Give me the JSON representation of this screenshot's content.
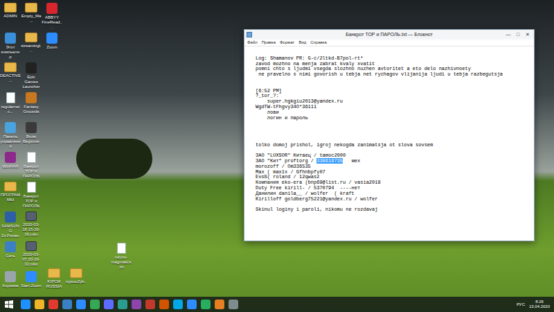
{
  "desktop": {
    "columns": [
      [
        {
          "label": "ADMIN",
          "kind": "folder",
          "color": "#e8b84a"
        },
        {
          "label": "Этот компьютер",
          "kind": "app",
          "color": "#3a8fd8"
        },
        {
          "label": "DEACTIVE ...",
          "kind": "folder",
          "color": "#e8b84a"
        },
        {
          "label": "regularnetc...",
          "kind": "file",
          "color": "#ffffff"
        },
        {
          "label": "Панель управления",
          "kind": "app",
          "color": "#4aa3df"
        },
        {
          "label": "WinRAR",
          "kind": "app",
          "color": "#8b2a8b"
        },
        {
          "label": "ПРОГРАММЫ",
          "kind": "folder",
          "color": "#e8b84a"
        },
        {
          "label": "SAMSUNG Dr.Printer",
          "kind": "app",
          "color": "#2c5fa8"
        },
        {
          "label": "Сеть",
          "kind": "app",
          "color": "#3b7fc4"
        },
        {
          "label": "Корзина",
          "kind": "app",
          "color": "#9aa4ad"
        }
      ],
      [
        {
          "label": "Empty_Ma...",
          "kind": "folder",
          "color": "#e8b84a"
        },
        {
          "label": "streamingl...",
          "kind": "folder",
          "color": "#e8b84a"
        },
        {
          "label": "Epic Games Launcher",
          "kind": "app",
          "color": "#222222"
        },
        {
          "label": "Fantasy Grounds",
          "kind": "app",
          "color": "#c8781e"
        },
        {
          "label": "Brute Beginner",
          "kind": "app",
          "color": "#3a3a3a"
        },
        {
          "label": "Банкрот ТОР и ПАРОЛЬ",
          "kind": "file",
          "color": "#ffffff"
        },
        {
          "label": "Банкрот ТОР и ПАРОЛЬ",
          "kind": "file",
          "color": "#ffffff"
        },
        {
          "label": "2020-03-18 15-26-36.mkv",
          "kind": "video",
          "color": "#556070"
        },
        {
          "label": "2020-03-07 20-29-32.mkv",
          "kind": "video",
          "color": "#556070"
        },
        {
          "label": "Start Zoom",
          "kind": "app",
          "color": "#2d8cff"
        }
      ],
      [
        {
          "label": "ABBYY FineRead...",
          "kind": "app",
          "color": "#d8262e"
        },
        {
          "label": "Zoom",
          "kind": "app",
          "color": "#2d8cff"
        }
      ]
    ],
    "bottom_row": [
      {
        "label": "ЮРСМ RUSSIA",
        "kind": "folder",
        "color": "#e8b84a"
      },
      {
        "label": "курсыZyk...",
        "kind": "folder",
        "color": "#e8b84a"
      }
    ],
    "loose_file": {
      "label": "rsforsi-magmatics.txt",
      "kind": "file",
      "color": "#ffffff"
    }
  },
  "window": {
    "title": "Банкрот ТОР и ПАРОЛЬ.txt — Блокнот",
    "controls": [
      "—",
      "□",
      "✕"
    ],
    "menu": [
      "Файл",
      "Правка",
      "Формат",
      "Вид",
      "Справка"
    ],
    "lines": [
      {
        "segments": []
      },
      {
        "segments": [
          {
            "text": "Log: Shamanov PR: G-c/2ltkd-B7pol-rt*",
            "selected": false
          }
        ]
      },
      {
        "segments": [
          {
            "text": "zavod mozhno na menja zabrat kvaly xvatit",
            "selected": false
          }
        ]
      },
      {
        "segments": [
          {
            "text": "pomni chto s ljudmi vsegda slozhno nuzhen avtoritet a eto delo nazhivnoety",
            "selected": false
          }
        ]
      },
      {
        "segments": [
          {
            "text": " ne pravelno s nimi govorish u tebja net rychagov vlijanija ljudi u tebja razbegutsja",
            "selected": false
          }
        ]
      },
      {
        "segments": []
      },
      {
        "segments": []
      },
      {
        "segments": [
          {
            "text": "[6:52 PM]",
            "selected": false
          }
        ]
      },
      {
        "segments": [
          {
            "text": "?_tor_?:",
            "selected": false
          }
        ]
      },
      {
        "segments": [
          {
            "text": "    super.hgkgiu2013@yandex.ru",
            "selected": false
          }
        ]
      },
      {
        "segments": [
          {
            "text": "WgdTW-tFhgvy34O*36111",
            "selected": false
          }
        ]
      },
      {
        "segments": [
          {
            "text": "    лови",
            "selected": false
          }
        ]
      },
      {
        "segments": [
          {
            "text": "    логин и пароль",
            "selected": false
          }
        ]
      },
      {
        "segments": []
      },
      {
        "segments": []
      },
      {
        "segments": []
      },
      {
        "segments": []
      },
      {
        "segments": [
          {
            "text": "tolko domoj prishol, igroj nekogda zanimatsja ot slova sovsem",
            "selected": false
          }
        ]
      },
      {
        "segments": []
      },
      {
        "segments": [
          {
            "text": "ЗАО \"LUXSOR\" Китаец / tamoc2000",
            "selected": false
          }
        ]
      },
      {
        "segments": [
          {
            "text": "ЗАО \"Кит\" proftorg / ",
            "selected": false
          },
          {
            "text": "338619735",
            "selected": true
          },
          {
            "text": "   мех",
            "selected": false
          }
        ]
      },
      {
        "segments": [
          {
            "text": "morozoff / Om336535",
            "selected": false
          }
        ]
      },
      {
        "segments": [
          {
            "text": "Max ( max1x / Gfhnbpfy07",
            "selected": false
          }
        ]
      },
      {
        "segments": [
          {
            "text": "EvoS( roland / 12qwasz",
            "selected": false
          }
        ]
      },
      {
        "segments": [
          {
            "text": "Компания eko-era (bnp69@list.ru / vasia2018",
            "selected": false
          }
        ]
      },
      {
        "segments": [
          {
            "text": "Duty Free kirill- / 5370794  ----нет",
            "selected": false
          }
        ]
      },
      {
        "segments": [
          {
            "text": "Данилин danila__ / wolfer  ( kraft",
            "selected": false
          }
        ]
      },
      {
        "segments": [
          {
            "text": "Kirilloff goldberg75221@yandex.ru / wolfer",
            "selected": false
          }
        ]
      },
      {
        "segments": []
      },
      {
        "segments": [
          {
            "text": "Skinul loginy i paroli, nikomu ne rozdavaj",
            "selected": false
          }
        ]
      }
    ]
  },
  "taskbar": {
    "apps": [
      {
        "color": "#1e90ff"
      },
      {
        "color": "#f0b429"
      },
      {
        "color": "#e23a2e"
      },
      {
        "color": "#3b7fc4"
      },
      {
        "color": "#2d8cff"
      },
      {
        "color": "#34a853"
      },
      {
        "color": "#5b6cff"
      },
      {
        "color": "#2a9d8f"
      },
      {
        "color": "#8e44ad"
      },
      {
        "color": "#c0392b"
      },
      {
        "color": "#d35400"
      },
      {
        "color": "#00a8e8"
      },
      {
        "color": "#2d8cff"
      },
      {
        "color": "#27ae60"
      },
      {
        "color": "#e67e22"
      },
      {
        "color": "#7f8c8d"
      }
    ],
    "language": "РУС",
    "time": "8:26",
    "date": "13.04.2020"
  }
}
